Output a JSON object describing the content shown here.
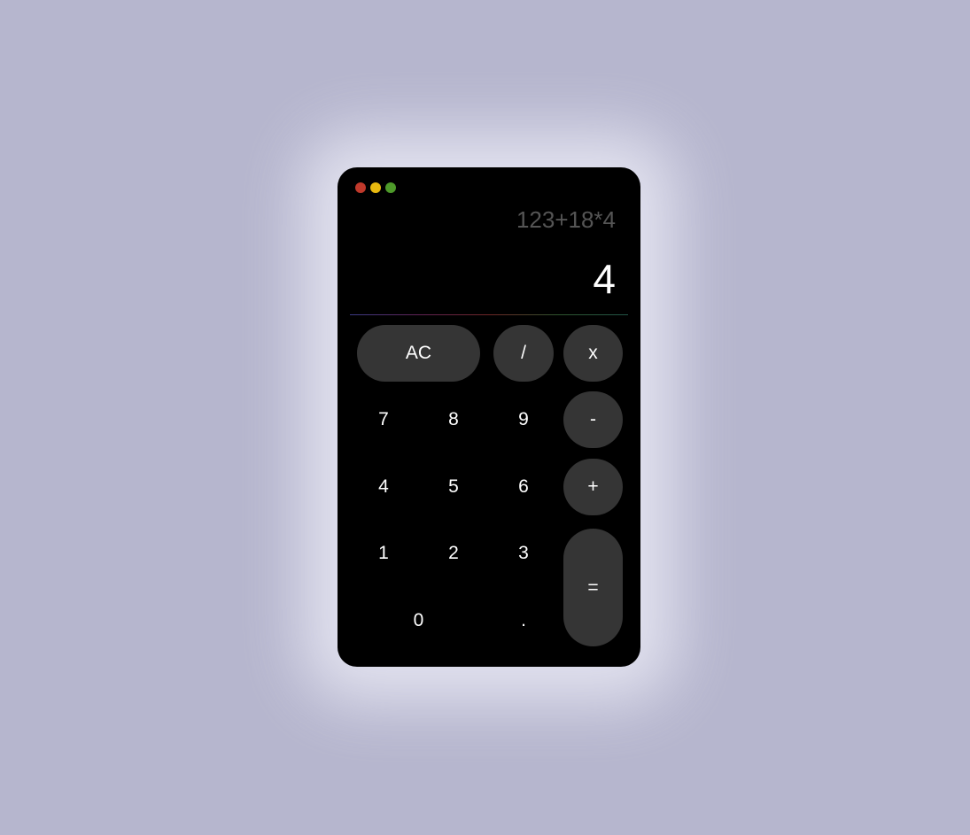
{
  "window": {
    "controls": [
      {
        "name": "close",
        "color": "#c0392b"
      },
      {
        "name": "minimize",
        "color": "#e8b90f"
      },
      {
        "name": "maximize",
        "color": "#4e9a2a"
      }
    ]
  },
  "display": {
    "expression": "123+18*4",
    "result": "4"
  },
  "keys": {
    "clear": "AC",
    "divide": "/",
    "multiply": "x",
    "seven": "7",
    "eight": "8",
    "nine": "9",
    "minus": "-",
    "four": "4",
    "five": "5",
    "six": "6",
    "plus": "+",
    "one": "1",
    "two": "2",
    "three": "3",
    "equals": "=",
    "zero": "0",
    "decimal": "."
  },
  "colors": {
    "background": "#b6b6ce",
    "calculator": "#000000",
    "operator_button": "#353535",
    "expression_text": "#555555",
    "result_text": "#ffffff"
  }
}
